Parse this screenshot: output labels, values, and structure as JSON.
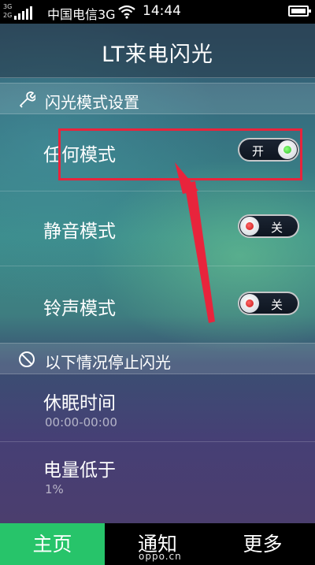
{
  "status_bar": {
    "network_tag_1": "3G",
    "network_tag_2": "2G",
    "carrier": "中国电信3G",
    "time": "14:44"
  },
  "header": {
    "title": "LT来电闪光"
  },
  "section_flash_mode": {
    "icon": "wrench-icon",
    "title": "闪光模式设置",
    "items": [
      {
        "label": "任何模式",
        "state": "开",
        "on": true
      },
      {
        "label": "静音模式",
        "state": "关",
        "on": false
      },
      {
        "label": "铃声模式",
        "state": "关",
        "on": false
      }
    ]
  },
  "section_stop": {
    "icon": "prohibited-icon",
    "title": "以下情况停止闪光",
    "items": [
      {
        "label": "休眠时间",
        "value": "00:00-00:00"
      },
      {
        "label": "电量低于",
        "value": "1%"
      }
    ]
  },
  "bottom_nav": {
    "items": [
      {
        "label": "主页",
        "active": true
      },
      {
        "label": "通知",
        "active": false
      },
      {
        "label": "更多",
        "active": false
      }
    ]
  },
  "watermark": "oppo.cn",
  "colors": {
    "accent_green": "#27c46a",
    "annotation_red": "#e8243c"
  }
}
